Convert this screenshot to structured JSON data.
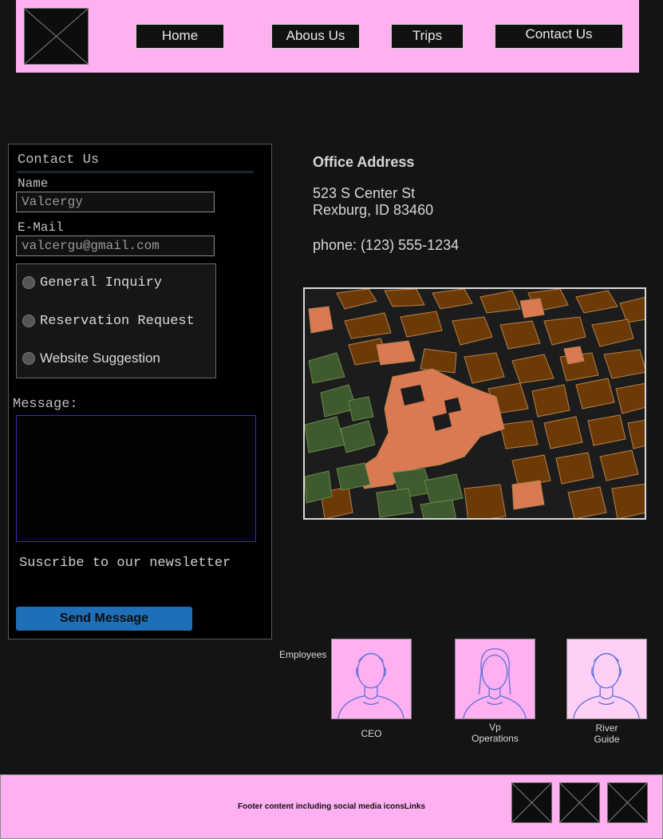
{
  "header": {
    "logo_icon": "image-placeholder-icon",
    "nav": [
      {
        "label": "Home"
      },
      {
        "label": "Abous Us"
      },
      {
        "label": "Trips"
      },
      {
        "label": "Contact Us"
      }
    ]
  },
  "form": {
    "title": "Contact Us",
    "name_label": "Name",
    "name_value": "Valcergy",
    "email_label": "E-Mail",
    "email_value": "valcergu@gmail.com",
    "options": [
      {
        "label": "General Inquiry"
      },
      {
        "label": "Reservation Request"
      },
      {
        "label": "Website Suggestion"
      }
    ],
    "message_label": "Message:",
    "newsletter_label": "Suscribe to our newsletter",
    "submit_label": "Send Message"
  },
  "office": {
    "heading": "Office Address",
    "street": "523 S Center St",
    "city": "Rexburg, ID 83460",
    "phone": "phone: (123) 555-1234"
  },
  "employees": {
    "heading": "Employees",
    "people": [
      {
        "role": "CEO"
      },
      {
        "role": "Vp\nOperations"
      },
      {
        "role": "River\nGuide"
      }
    ]
  },
  "footer": {
    "text": "Footer content including social media iconsLinks",
    "social_icons": [
      "image-placeholder-icon",
      "image-placeholder-icon",
      "image-placeholder-icon"
    ]
  },
  "colors": {
    "header_bg": "#ffb0f0",
    "page_bg": "#141414",
    "button_blue": "#1f6fb8",
    "map_block": "#6b3a06",
    "map_plaza": "#d97a52",
    "map_park": "#3f5a2e"
  }
}
